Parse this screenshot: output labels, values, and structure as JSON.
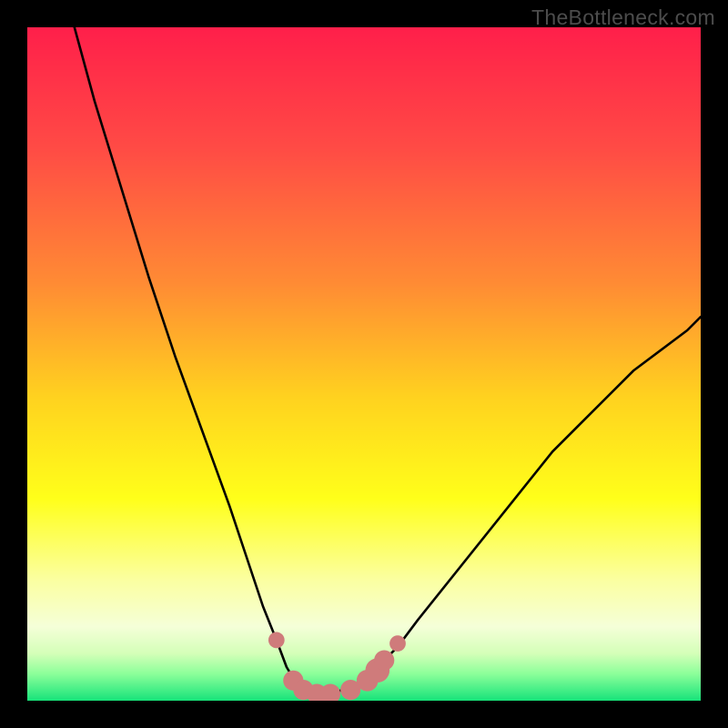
{
  "watermark": "TheBottleneck.com",
  "chart_data": {
    "type": "line",
    "title": "",
    "xlabel": "",
    "ylabel": "",
    "xlim": [
      0,
      100
    ],
    "ylim": [
      0,
      100
    ],
    "series": [
      {
        "name": "curve",
        "x": [
          7,
          10,
          14,
          18,
          22,
          26,
          30,
          33,
          35,
          37,
          38.5,
          40,
          42,
          44,
          46,
          49,
          52,
          55,
          58,
          62,
          66,
          70,
          74,
          78,
          82,
          86,
          90,
          94,
          98,
          100
        ],
        "y": [
          100,
          89,
          76,
          63,
          51,
          40,
          29,
          20,
          14,
          9,
          5,
          2.5,
          1.3,
          1.0,
          1.3,
          2.5,
          5,
          8,
          12,
          17,
          22,
          27,
          32,
          37,
          41,
          45,
          49,
          52,
          55,
          57
        ]
      }
    ],
    "markers": {
      "name": "highlight-dots",
      "color": "#cf7b7b",
      "points": [
        {
          "x": 37.0,
          "y": 9.0,
          "r": 1.2
        },
        {
          "x": 39.5,
          "y": 3.0,
          "r": 1.5
        },
        {
          "x": 41.0,
          "y": 1.6,
          "r": 1.5
        },
        {
          "x": 43.0,
          "y": 1.0,
          "r": 1.5
        },
        {
          "x": 45.0,
          "y": 1.0,
          "r": 1.5
        },
        {
          "x": 48.0,
          "y": 1.6,
          "r": 1.5
        },
        {
          "x": 50.5,
          "y": 3.0,
          "r": 1.6
        },
        {
          "x": 52.0,
          "y": 4.5,
          "r": 1.8
        },
        {
          "x": 53.0,
          "y": 6.0,
          "r": 1.5
        },
        {
          "x": 55.0,
          "y": 8.5,
          "r": 1.2
        }
      ]
    },
    "gradient_stops": [
      {
        "pos": 0.0,
        "color": "#ff1f4a"
      },
      {
        "pos": 0.18,
        "color": "#ff4b45"
      },
      {
        "pos": 0.38,
        "color": "#ff8b34"
      },
      {
        "pos": 0.55,
        "color": "#ffd21f"
      },
      {
        "pos": 0.7,
        "color": "#ffff1a"
      },
      {
        "pos": 0.82,
        "color": "#fbffa0"
      },
      {
        "pos": 0.89,
        "color": "#f5ffd8"
      },
      {
        "pos": 0.93,
        "color": "#d4ffb8"
      },
      {
        "pos": 0.96,
        "color": "#8cff9a"
      },
      {
        "pos": 1.0,
        "color": "#17e37a"
      }
    ]
  }
}
